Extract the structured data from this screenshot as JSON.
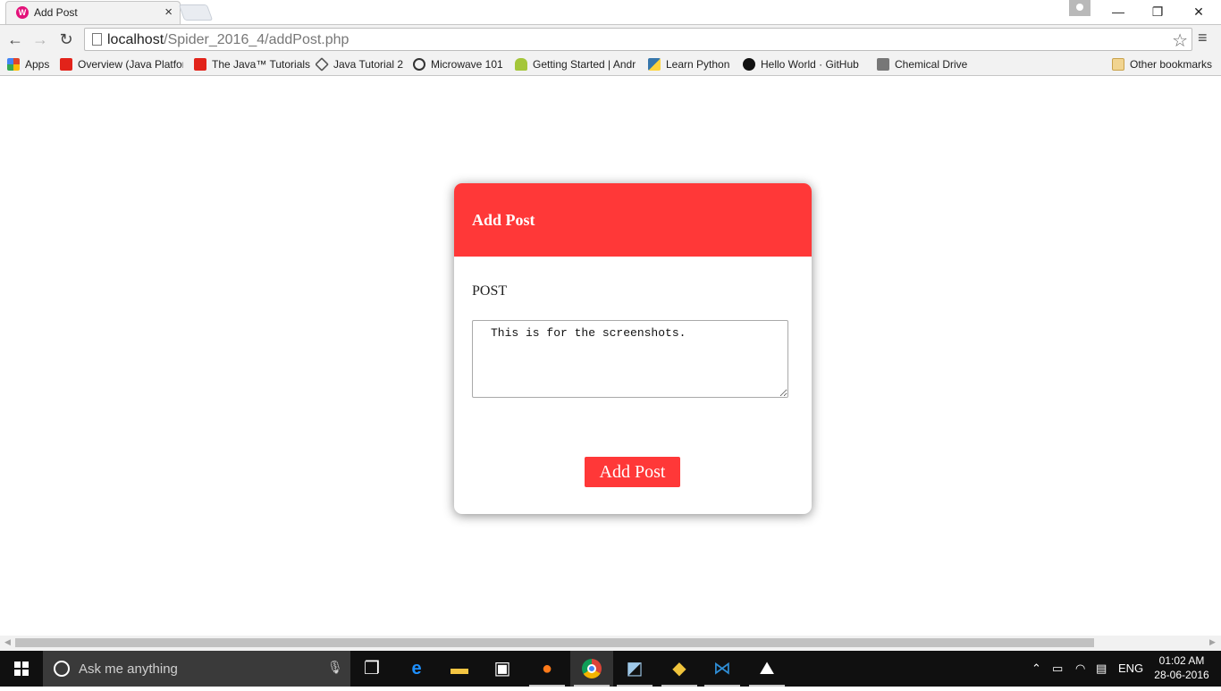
{
  "browser": {
    "tab_title": "Add Post",
    "tab_close": "×",
    "window_controls": {
      "minimize": "—",
      "restore": "❐",
      "close": "✕"
    },
    "nav": {
      "back": "←",
      "forward": "→",
      "reload": "↻"
    },
    "url_host": "localhost",
    "url_path": "/Spider_2016_4/addPost.php",
    "star": "☆",
    "menu": "≡"
  },
  "bookmarks": [
    {
      "label": "Apps",
      "icon": "apps-grid-icon",
      "color": "#e0442a"
    },
    {
      "label": "Overview (Java Platfor",
      "icon": "oracle-icon",
      "color": "#e2231a"
    },
    {
      "label": "The Java™ Tutorials",
      "icon": "oracle-icon",
      "color": "#e2231a"
    },
    {
      "label": "Java Tutorial 2",
      "icon": "diamond-icon",
      "color": "#555555"
    },
    {
      "label": "Microwave 101",
      "icon": "globe-icon",
      "color": "#333333"
    },
    {
      "label": "Getting Started | Andr",
      "icon": "android-icon",
      "color": "#a4c639"
    },
    {
      "label": "Learn Python",
      "icon": "python-icon",
      "color": "#3776ab"
    },
    {
      "label": "Hello World · GitHub",
      "icon": "github-icon",
      "color": "#111111"
    },
    {
      "label": "Chemical Drive",
      "icon": "drive-folder-icon",
      "color": "#777777"
    }
  ],
  "other_bookmarks": "Other bookmarks",
  "page": {
    "heading": "Add Post",
    "field_label": "POST",
    "textarea_value": "This is for the screenshots.",
    "submit_label": "Add Post",
    "accent_color": "#ff3838"
  },
  "taskbar": {
    "search_placeholder": "Ask me anything",
    "tray_language": "ENG",
    "time": "01:02 AM",
    "date": "28-06-2016"
  }
}
